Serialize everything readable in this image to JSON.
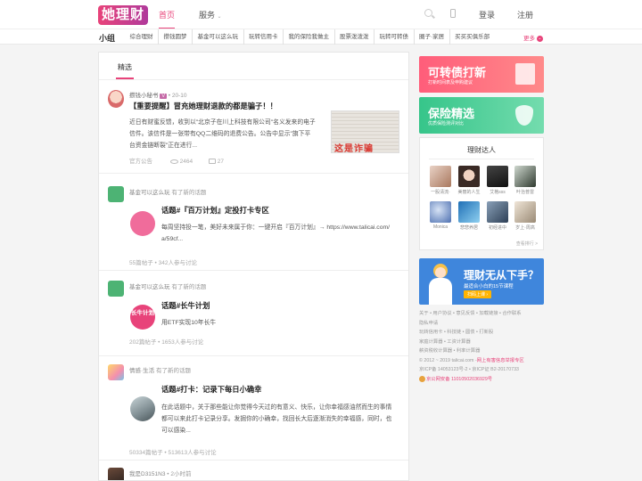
{
  "header": {
    "logo": "她理财",
    "nav_home": "首页",
    "nav_service": "服务",
    "login": "登录",
    "register": "注册"
  },
  "subnav": {
    "label": "小组",
    "links": [
      "综合理财",
      "攒钱圆梦",
      "基金可以这么玩",
      "玩转信用卡",
      "我的保险我做主",
      "股票泼泼泼",
      "玩转可转债",
      "圈子·家居",
      "买买买俱乐部"
    ],
    "more": "更多"
  },
  "feed": {
    "tab": "精选",
    "posts": [
      {
        "author": "攒钱小秘书",
        "badge": "V",
        "date": "20-10",
        "title": "【重要提醒】冒充她理财退款的都是骗子！！",
        "lines": [
          "近日有财蜜反馈，收到以\"北京子在川上科技有限公司\"名义发来的电子",
          "信件。该信件是一张带有QQ二维码的退费公告。公告中显示\"旗下平",
          "台资金链断裂\"正在进行..."
        ],
        "source": "官方公告",
        "views": "2464",
        "comments": "27",
        "thumb_text": "这是诈骗"
      },
      {
        "group": "基金可以这么玩",
        "action": "有了新的话题",
        "topic": "话题#『百万计划』定投打卡专区",
        "lines": [
          "每周坚持投一笔，美好未来属于你：一键开启『百万计划』→ https://www.talicai.com/",
          "a/59cf..."
        ],
        "stats": "55篇帖子 • 342人参与讨论"
      },
      {
        "group": "基金可以这么玩",
        "action": "有了新的话题",
        "topic": "话题#长牛计划",
        "badge_text": "长牛计划",
        "lines": [
          "用ETF实现10年长牛"
        ],
        "stats": "202篇帖子 • 1653人参与讨论"
      },
      {
        "group": "情感·生活",
        "action": "有了新的话题",
        "topic": "话题#打卡：记录下每日小确幸",
        "lines": [
          "在此话题中，关于那些能让你觉得今天过的有意义、快乐，让你幸福感油然而生的事情",
          "都可以来此打卡记录分享。发掘你的小确幸，找回长大后逐渐消失的幸福感，同时，也",
          "可以感染..."
        ],
        "stats": "50334篇帖子 • 513613人参与讨论"
      },
      {
        "author": "我是D3151N3",
        "date": "2小时前"
      }
    ]
  },
  "sidebar": {
    "banner1_title": "可转债打新",
    "banner1_sub": "打新时间表及申购建议",
    "banner2_title": "保险精选",
    "banner2_sub": "优质保险测评对比",
    "experts_title": "理财达人",
    "experts": [
      "一股清流·",
      "美丽的人生",
      "艾格sss",
      "叶治普雷",
      "Monica",
      "悲悲养居",
      "初经进中",
      "岁上·周高"
    ],
    "experts_more": "查看排行 >",
    "course_title": "理财无从下手？",
    "course_sub": "最适合小白的15节课程",
    "course_btn": "扫码上课 ›",
    "footer_lines": [
      "关于 • 用户协议 • 意见反馈 • 加载链接 • 合作联系",
      "隐私申请",
      "玩转信用卡 • 科技链 • 圆债 • 打新股",
      "家庭计算器 • 工资计算器",
      "薪资税收计算器 • 利率计算器"
    ],
    "copyright": "© 2012 ~ 2019 talicai.com -",
    "copyright_red": "网上有害信息举报专区",
    "icp1": "京ICP备 14053123号-2 • 京ICP证 B2-20170733",
    "police": "京公网安备 11010502036929号"
  },
  "colors": {
    "brand": "#e8437a",
    "course": "#3f86dc"
  }
}
